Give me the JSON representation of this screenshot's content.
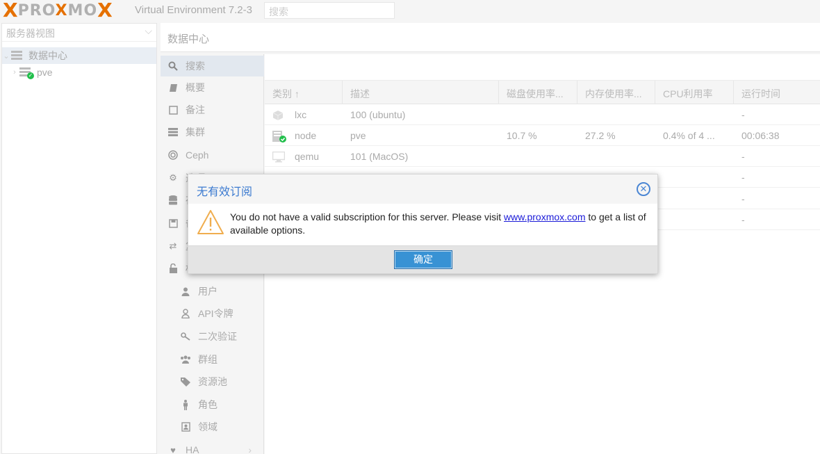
{
  "app": {
    "logo_x": "X",
    "logo_prefix": "PRO",
    "logo_x2": "X",
    "logo_mid": "MO",
    "logo_x3": "X",
    "version": "Virtual Environment 7.2-3",
    "search_placeholder": "搜索"
  },
  "tree": {
    "view_label": "服务器视图",
    "datacenter": "数据中心",
    "node": "pve"
  },
  "content": {
    "title": "数据中心"
  },
  "nav": {
    "items": [
      {
        "label": "搜索",
        "icon": "search-icon"
      },
      {
        "label": "概要",
        "icon": "book-icon"
      },
      {
        "label": "备注",
        "icon": "note-icon"
      },
      {
        "label": "集群",
        "icon": "server-icon"
      },
      {
        "label": "Ceph",
        "icon": "ceph-icon"
      },
      {
        "label": "选项",
        "icon": "gear-icon"
      },
      {
        "label": "存储",
        "icon": "database-icon"
      },
      {
        "label": "备份",
        "icon": "save-icon"
      },
      {
        "label": "复制",
        "icon": "retweet-icon"
      },
      {
        "label": "权限",
        "icon": "unlock-icon"
      }
    ],
    "sub_items": [
      {
        "label": "用户",
        "icon": "user-icon"
      },
      {
        "label": "API令牌",
        "icon": "user-outline-icon"
      },
      {
        "label": "二次验证",
        "icon": "key-icon"
      },
      {
        "label": "群组",
        "icon": "users-icon"
      },
      {
        "label": "资源池",
        "icon": "tags-icon"
      },
      {
        "label": "角色",
        "icon": "male-icon"
      },
      {
        "label": "领域",
        "icon": "address-book-icon"
      }
    ],
    "ha": {
      "label": "HA",
      "icon": "heartbeat-icon"
    }
  },
  "grid": {
    "headers": [
      "类别 ↑",
      "描述",
      "磁盘使用率...",
      "内存使用率...",
      "CPU利用率",
      "运行时间"
    ],
    "rows": [
      {
        "type": "lxc",
        "desc": "100 (ubuntu)",
        "disk": "",
        "mem": "",
        "cpu": "",
        "uptime": "-"
      },
      {
        "type": "node",
        "desc": "pve",
        "disk": "10.7 %",
        "mem": "27.2 %",
        "cpu": "0.4% of 4 ...",
        "uptime": "00:06:38"
      },
      {
        "type": "qemu",
        "desc": "101 (MacOS)",
        "disk": "",
        "mem": "",
        "cpu": "",
        "uptime": "-"
      },
      {
        "type": "",
        "desc": "",
        "disk": "",
        "mem": "",
        "cpu": "",
        "uptime": "-"
      },
      {
        "type": "",
        "desc": "",
        "disk": "",
        "mem": "",
        "cpu": "",
        "uptime": "-"
      },
      {
        "type": "",
        "desc": "",
        "disk": "",
        "mem": "",
        "cpu": "",
        "uptime": "-"
      }
    ]
  },
  "dialog": {
    "title": "无有效订阅",
    "message_before": "You do not have a valid subscription for this server. Please visit ",
    "link": "www.proxmox.com",
    "message_after": " to get a list of available options.",
    "ok_label": "确定"
  },
  "colors": {
    "accent": "#3892d4",
    "logo_orange": "#e57000",
    "title_blue": "#3b7ad0",
    "warning_yellow": "#f0ad4e"
  }
}
